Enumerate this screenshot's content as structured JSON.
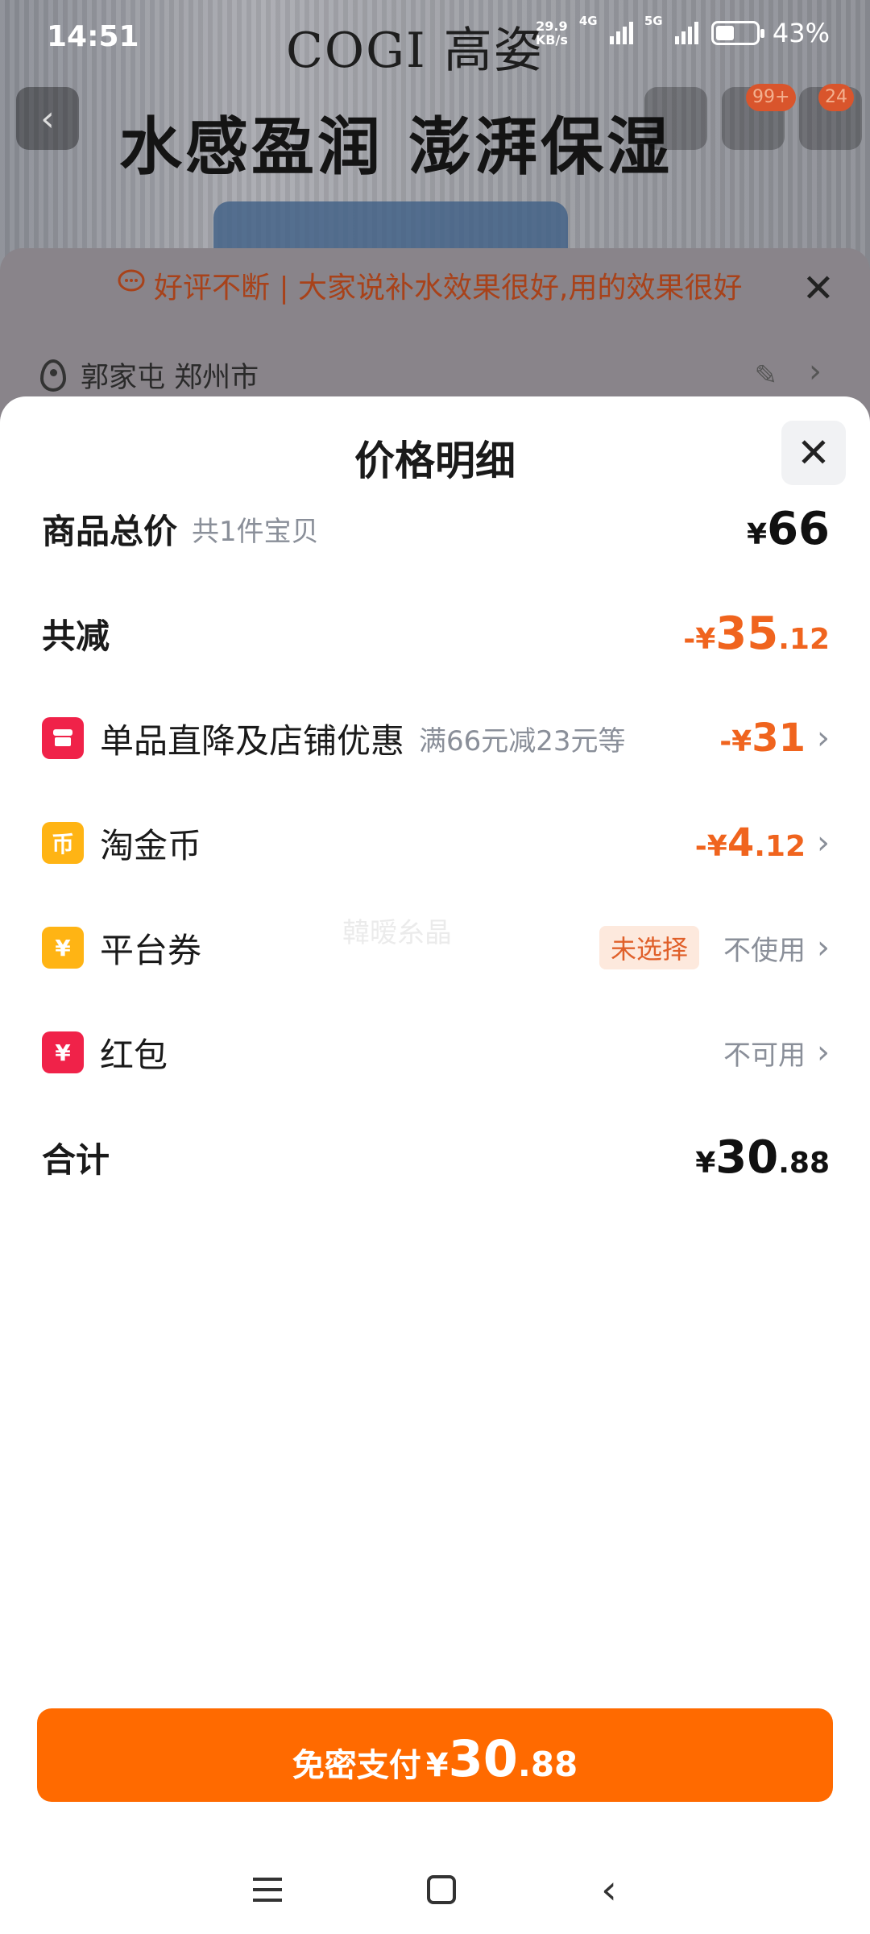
{
  "status_bar": {
    "time": "14:51",
    "brand": "COGI 高姿",
    "net_speed_value": "29.9",
    "net_speed_unit": "KB/s",
    "signal_1": "4G",
    "signal_2": "5G",
    "battery": "43%"
  },
  "background_page": {
    "banner_slogan": "水感盈润 澎湃保湿",
    "cart_badge": "99+",
    "more_badge": "24",
    "review_text": "好评不断 | 大家说补水效果很好,用的效果很好",
    "address": "郭家屯 郑州市"
  },
  "sheet": {
    "title": "价格明细",
    "rows": {
      "total": {
        "label": "商品总价",
        "sub": "共1件宝贝",
        "currency": "¥",
        "int": "66",
        "dec": ""
      },
      "reduced": {
        "label": "共减",
        "prefix": "-",
        "currency": "¥",
        "int": "35",
        "dec": ".12"
      },
      "shop_discount": {
        "label": "单品直降及店铺优惠",
        "sub": "满66元减23元等",
        "prefix": "-",
        "currency": "¥",
        "int": "31",
        "dec": ""
      },
      "coins": {
        "label": "淘金币",
        "prefix": "-",
        "currency": "¥",
        "int": "4",
        "dec": ".12"
      },
      "coupon": {
        "label": "平台券",
        "pill": "未选择",
        "status": "不使用"
      },
      "red_packet": {
        "label": "红包",
        "status": "不可用"
      },
      "sum": {
        "label": "合计",
        "currency": "¥",
        "int": "30",
        "dec": ".88"
      }
    },
    "watermark": "韓暧糸晶"
  },
  "pay_button": {
    "label": "免密支付",
    "currency": "¥",
    "int": "30",
    "dec": ".88"
  },
  "colors": {
    "accent_orange": "#ff6a00",
    "discount_orange": "#f0641e",
    "icon_red": "#f02249",
    "icon_yellow": "#ffb414"
  }
}
